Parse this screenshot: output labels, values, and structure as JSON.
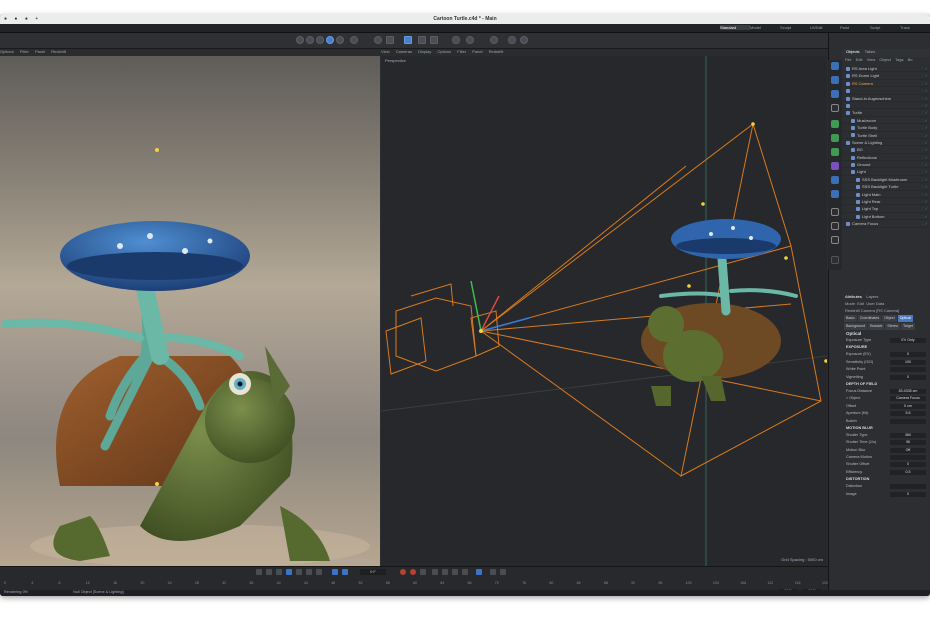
{
  "window": {
    "title": "Cartoon Turtle.c4d * - Main"
  },
  "layouts": [
    "Standard",
    "Model",
    "Sculpt",
    "UVEdit",
    "Paint",
    "Script",
    "Track"
  ],
  "active_layout": "Standard",
  "viewport_left": {
    "menu": [
      "Options",
      "Filter",
      "Panel",
      "Redshift"
    ],
    "grid_spacing": "Grid Spacing : 50000 cm"
  },
  "viewport_right": {
    "menu": [
      "View",
      "Cameras",
      "Display",
      "Options",
      "Filter",
      "Panel",
      "Redshift"
    ],
    "label": "Perspective",
    "grid_spacing": "Grid Spacing : 5000 cm"
  },
  "panel": {
    "tabs": [
      "Objects",
      "Takes"
    ],
    "menu": [
      "File",
      "Edit",
      "View",
      "Object",
      "Tags",
      "Bo"
    ],
    "tree": [
      {
        "label": "RS Area Light",
        "indent": 0
      },
      {
        "label": "RS Dome Light",
        "indent": 0
      },
      {
        "label": "RS Camera",
        "indent": 0,
        "state": "highlight"
      },
      {
        "label": "",
        "indent": 0
      },
      {
        "label": "Stand-in Augenschirm",
        "indent": 0
      },
      {
        "label": "",
        "indent": 0
      },
      {
        "label": "Turtle",
        "indent": 0
      },
      {
        "label": "Mushroom",
        "indent": 1
      },
      {
        "label": "Turtle Body",
        "indent": 1
      },
      {
        "label": "Turtle Shell",
        "indent": 1
      },
      {
        "label": "Scene & Lighting",
        "indent": 0
      },
      {
        "label": "BG",
        "indent": 1
      },
      {
        "label": "Reflections",
        "indent": 1
      },
      {
        "label": "Ground",
        "indent": 1
      },
      {
        "label": "Light",
        "indent": 1
      },
      {
        "label": "SSS Backlight Mushroom",
        "indent": 2
      },
      {
        "label": "SSS Backlight Turtle",
        "indent": 2
      },
      {
        "label": "Light Main",
        "indent": 2
      },
      {
        "label": "Light Rear",
        "indent": 2
      },
      {
        "label": "Light Top",
        "indent": 2
      },
      {
        "label": "Light Bottom",
        "indent": 2
      },
      {
        "label": "Camera Focus",
        "indent": 0
      }
    ]
  },
  "attributes": {
    "tabs": [
      "Attributes",
      "Layers"
    ],
    "menu": [
      "Mode",
      "Edit",
      "User Data"
    ],
    "object": "Redshift Camera [RS Camera]",
    "subtabs": [
      "Basic",
      "Coordinates",
      "Object",
      "Optical",
      "Background",
      "Bracket",
      "Stereo",
      "Target"
    ],
    "active_subtab": "Optical",
    "section": "Optical",
    "props": [
      {
        "label": "Exposure Type",
        "value": "EV Only"
      },
      {
        "label": "EXPOSURE",
        "section": true
      },
      {
        "label": "Exposure (EV)",
        "value": "0"
      },
      {
        "label": "Sensitivity (ISO)",
        "value": "100"
      },
      {
        "label": "White Point",
        "value": ""
      },
      {
        "label": "Vignetting",
        "value": "0"
      },
      {
        "label": "DEPTH OF FIELD",
        "section": true
      },
      {
        "label": "Focus Distance",
        "value": "83.4335 cm"
      },
      {
        "label": "> Object",
        "value": "Camera Focus"
      },
      {
        "label": "Offset",
        "value": "0 cm"
      },
      {
        "label": "Aperture (f/#)",
        "value": "5.6"
      },
      {
        "label": "Bokeh",
        "value": ""
      },
      {
        "label": "MOTION BLUR",
        "section": true
      },
      {
        "label": "Shutter Type",
        "value": "360"
      },
      {
        "label": "Shutter Time (1/s)",
        "value": "96"
      },
      {
        "label": "Motion Blur",
        "value": "Off"
      },
      {
        "label": "Camera Motion",
        "value": ""
      },
      {
        "label": "Shutter Offset",
        "value": "0"
      },
      {
        "label": "Efficiency",
        "value": "0.5"
      },
      {
        "label": "DISTORTION",
        "section": true
      },
      {
        "label": "Distortion",
        "value": ""
      },
      {
        "label": "Image",
        "value": "0"
      }
    ]
  },
  "timeline": {
    "current_frame": "0 F",
    "ticks": [
      "0",
      "4",
      "8",
      "12",
      "16",
      "20",
      "24",
      "28",
      "32",
      "36",
      "40",
      "44",
      "48",
      "52",
      "56",
      "60",
      "64",
      "68",
      "72",
      "76",
      "80",
      "84",
      "88",
      "92",
      "96",
      "100",
      "104",
      "108",
      "112",
      "116",
      "120"
    ],
    "end_a": "90 F",
    "end_b": "90 F"
  },
  "status": {
    "left": "Rendering 0%",
    "middle": "Null Object [Scene & Lighting]"
  },
  "colors": {
    "accent": "#3b6fb6",
    "camera_lines": "#d97a1e",
    "selection": "#3a5c8a"
  }
}
